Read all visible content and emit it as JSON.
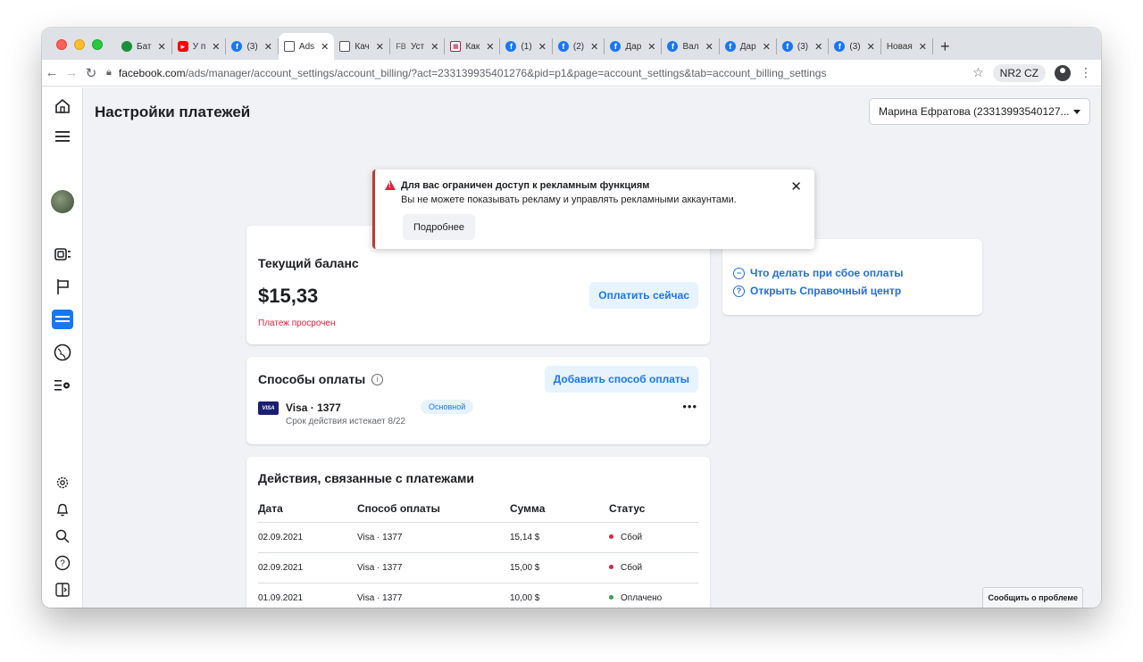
{
  "browser": {
    "tabs": [
      {
        "icon": "green-circle-icon",
        "label": "Бат",
        "active": false
      },
      {
        "icon": "youtube-icon",
        "label": "У п",
        "active": false
      },
      {
        "icon": "facebook-icon",
        "label": "(3)",
        "active": false
      },
      {
        "icon": "doc-icon",
        "label": "Ads",
        "active": true
      },
      {
        "icon": "doc-icon",
        "label": "Кач",
        "active": false
      },
      {
        "icon": "text-icon",
        "label": "Уст",
        "prefix": "FB",
        "active": false
      },
      {
        "icon": "grid-icon",
        "label": "Как",
        "active": false
      },
      {
        "icon": "facebook-icon",
        "label": "(1)",
        "active": false
      },
      {
        "icon": "facebook-icon",
        "label": "(2)",
        "active": false
      },
      {
        "icon": "facebook-icon",
        "label": "Дар",
        "active": false
      },
      {
        "icon": "facebook-icon",
        "label": "Вал",
        "active": false
      },
      {
        "icon": "facebook-icon",
        "label": "Дар",
        "active": false
      },
      {
        "icon": "facebook-icon",
        "label": "(3)",
        "active": false
      },
      {
        "icon": "facebook-icon",
        "label": "(3)",
        "active": false
      },
      {
        "icon": "none",
        "label": "Новая",
        "active": false
      }
    ],
    "url_host": "facebook.com",
    "url_path": "/ads/manager/account_settings/account_billing/?act=233139935401276&pid=p1&page=account_settings&tab=account_billing_settings",
    "profile_label": "NR2 CZ"
  },
  "header": {
    "title": "Настройки платежей",
    "account": "Марина Ефратова (23313993540127..."
  },
  "alert": {
    "title": "Для вас ограничен доступ к рекламным функциям",
    "text": "Вы не можете показывать рекламу и управлять рекламными аккаунтами.",
    "button": "Подробнее"
  },
  "balance": {
    "title": "Текущий баланс",
    "amount": "$15,33",
    "status": "Платеж просрочен",
    "pay_button": "Оплатить сейчас"
  },
  "help": {
    "links": [
      {
        "icon": "minus-circle-icon",
        "label": "Что делать при сбое оплаты"
      },
      {
        "icon": "question-circle-icon",
        "label": "Открыть Справочный центр"
      }
    ]
  },
  "methods": {
    "title": "Способы оплаты",
    "add_button": "Добавить способ оплаты",
    "card_brand": "VISA",
    "card_name": "Visa · 1377",
    "card_expiry": "Срок действия истекает 8/22",
    "primary_badge": "Основной"
  },
  "transactions": {
    "title": "Действия, связанные с платежами",
    "columns": [
      "Дата",
      "Способ оплаты",
      "Сумма",
      "Статус"
    ],
    "rows": [
      {
        "date": "02.09.2021",
        "method": "Visa · 1377",
        "amount": "15,14 $",
        "status": "Сбой",
        "status_color": "#e41e3f"
      },
      {
        "date": "02.09.2021",
        "method": "Visa · 1377",
        "amount": "15,00 $",
        "status": "Сбой",
        "status_color": "#e41e3f"
      },
      {
        "date": "01.09.2021",
        "method": "Visa · 1377",
        "amount": "10,00 $",
        "status": "Оплачено",
        "status_color": "#31a24c"
      }
    ]
  },
  "footer": {
    "report_button": "Сообщить о проблеме"
  },
  "colors": {
    "accent": "#1877f2",
    "error": "#e41e3f",
    "success": "#31a24c"
  }
}
